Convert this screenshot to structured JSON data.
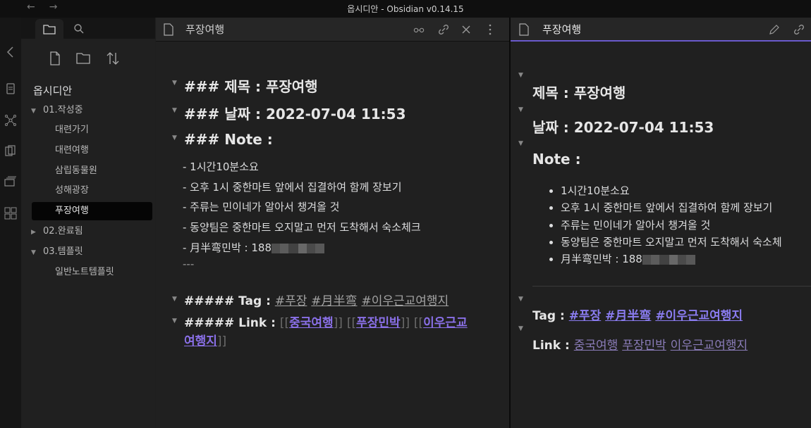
{
  "window": {
    "title": "옵시디안 - Obsidian v0.14.15",
    "back": "←",
    "forward": "→"
  },
  "sidebar": {
    "vault_name": "옵시디안",
    "tree": [
      {
        "type": "folder",
        "label": "01.작성중",
        "expanded": true
      },
      {
        "type": "file",
        "label": "대련가기"
      },
      {
        "type": "file",
        "label": "대련여행"
      },
      {
        "type": "file",
        "label": "삼립동물원"
      },
      {
        "type": "file",
        "label": "성해광장"
      },
      {
        "type": "file",
        "label": "푸장여행",
        "active": true
      },
      {
        "type": "folder",
        "label": "02.완료됨",
        "expanded": false
      },
      {
        "type": "folder",
        "label": "03.템플릿",
        "expanded": true
      },
      {
        "type": "file",
        "label": "일반노트템플릿"
      }
    ]
  },
  "editor": {
    "title": "푸장여행",
    "h_title": "### 제목 : 푸장여행",
    "h_date": "### 날짜 : 2022-07-04 11:53",
    "h_note": "### Note :",
    "items": [
      "- 1시간10분소요",
      "- 오후 1시 중한마트 앞에서 집결하여 함께 장보기",
      "- 주류는 민이네가 알아서 챙겨올 것",
      "- 동양팀은 중한마트 오지말고 먼저 도착해서 숙소체크",
      "- 月半弯민박 : 188"
    ],
    "hr": "---",
    "tag_prefix": "##### Tag : ",
    "tags": [
      "#푸장",
      "#月半弯",
      "#이우근교여행지"
    ],
    "link_prefix": "##### Link : ",
    "links": [
      "중국여행",
      "푸장민박",
      "이우근교",
      "여행지"
    ],
    "bracket_open": "[[",
    "bracket_close": "]]"
  },
  "preview": {
    "title": "푸장여행",
    "h_title": "제목 : 푸장여행",
    "h_date": "날짜 : 2022-07-04 11:53",
    "h_note": "Note :",
    "items": [
      "1시간10분소요",
      "오후 1시 중한마트 앞에서 집결하여 함께 장보기",
      "주류는 민이네가 알아서 챙겨올 것",
      "동양팀은 중한마트 오지말고 먼저 도착해서 숙소체",
      "月半弯민박 : 188"
    ],
    "tag_label": "Tag : ",
    "tags": [
      "#푸장",
      "#月半弯",
      "#이우근교여행지"
    ],
    "link_label": "Link : ",
    "links": [
      "중국여행",
      "푸장민박",
      "이우근교여행지"
    ]
  }
}
